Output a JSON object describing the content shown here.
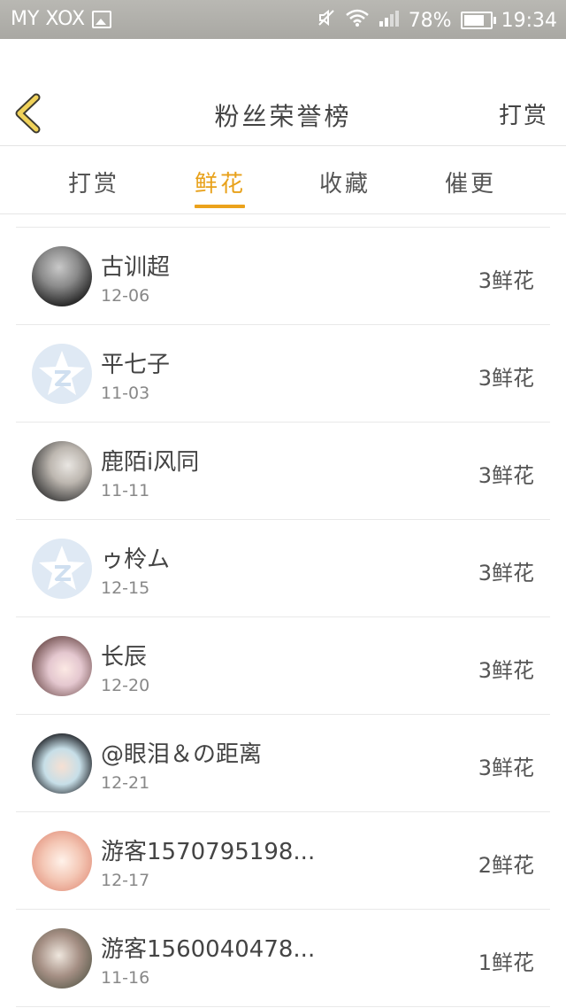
{
  "status_bar": {
    "carrier": "MY XOX",
    "battery": "78%",
    "battery_level": 0.78,
    "time": "19:34",
    "icons": [
      "image-icon",
      "mute-icon",
      "wifi-icon",
      "signal-icon",
      "battery-icon"
    ]
  },
  "header": {
    "back_icon": "chevron-left-icon",
    "title": "粉丝荣誉榜",
    "right_link": "打赏"
  },
  "tabs": [
    {
      "label": "打赏",
      "active": false
    },
    {
      "label": "鲜花",
      "active": true
    },
    {
      "label": "收藏",
      "active": false
    },
    {
      "label": "催更",
      "active": false
    }
  ],
  "colors": {
    "accent": "#e8a11a",
    "text": "#444444",
    "muted": "#888888",
    "divider": "#e9e9e9"
  },
  "fans": [
    {
      "name": "古训超",
      "date": "12-06",
      "count": "3鲜花",
      "avatar": "photo-avatar"
    },
    {
      "name": "平七子",
      "date": "11-03",
      "count": "3鲜花",
      "avatar": "default-star-avatar"
    },
    {
      "name": "鹿陌i风同",
      "date": "11-11",
      "count": "3鲜花",
      "avatar": "photo-avatar"
    },
    {
      "name": "ゥ柃ム",
      "date": "12-15",
      "count": "3鲜花",
      "avatar": "default-star-avatar"
    },
    {
      "name": "长辰",
      "date": "12-20",
      "count": "3鲜花",
      "avatar": "photo-avatar"
    },
    {
      "name": "@眼泪＆の距离",
      "date": "12-21",
      "count": "3鲜花",
      "avatar": "photo-avatar"
    },
    {
      "name": "游客1570795198...",
      "date": "12-17",
      "count": "2鲜花",
      "avatar": "photo-avatar"
    },
    {
      "name": "游客1560040478...",
      "date": "11-16",
      "count": "1鲜花",
      "avatar": "photo-avatar"
    }
  ]
}
